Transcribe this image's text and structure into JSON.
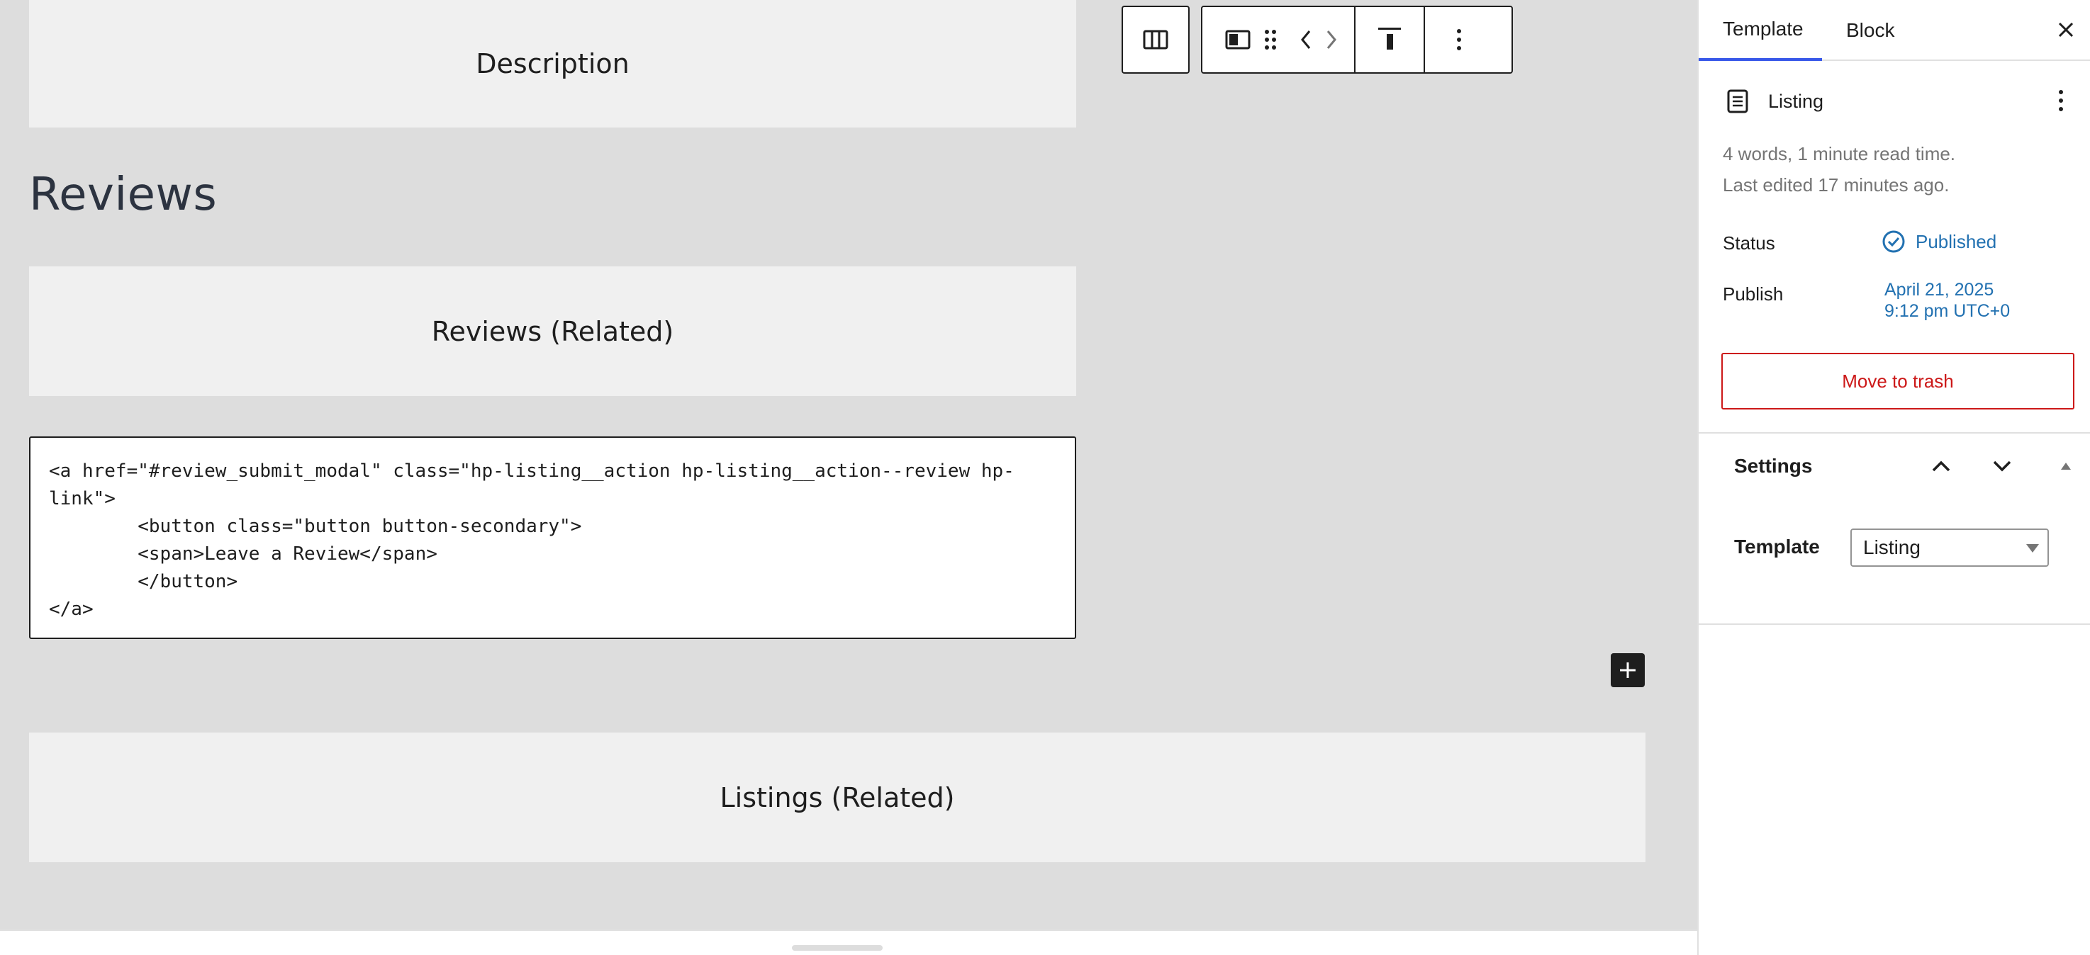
{
  "canvas": {
    "description_label": "Description",
    "reviews_heading": "Reviews",
    "reviews_related_label": "Reviews (Related)",
    "code_lines": [
      "<a href=\"#review_submit_modal\" class=\"hp-listing__action hp-listing__action--review hp-",
      "link\">",
      "        <button class=\"button button-secondary\">",
      "        <span>Leave a Review</span>",
      "        </button>",
      "</a>"
    ],
    "listings_related_label": "Listings (Related)"
  },
  "toolbar": {
    "icons": [
      "columns-icon",
      "media-text-icon",
      "drag-handle-icon",
      "move-left-icon",
      "move-right-icon",
      "align-top-icon",
      "more-options-icon"
    ]
  },
  "sidebar": {
    "tabs": [
      {
        "label": "Template",
        "active": true
      },
      {
        "label": "Block",
        "active": false
      }
    ],
    "template_name": "Listing",
    "meta_words": "4 words, 1 minute read time.",
    "meta_edited": "Last edited 17 minutes ago.",
    "status_label": "Status",
    "status_value": "Published",
    "publish_label": "Publish",
    "publish_date": "April 21, 2025",
    "publish_time": "9:12 pm UTC+0",
    "trash_label": "Move to trash",
    "settings_title": "Settings",
    "template_field_label": "Template",
    "template_select_value": "Listing"
  },
  "colors": {
    "accent": "#3858e9",
    "link": "#2271b1",
    "danger": "#cc1818",
    "canvas_bg": "#dddddd",
    "placeholder_bg": "#f0f0f0"
  }
}
